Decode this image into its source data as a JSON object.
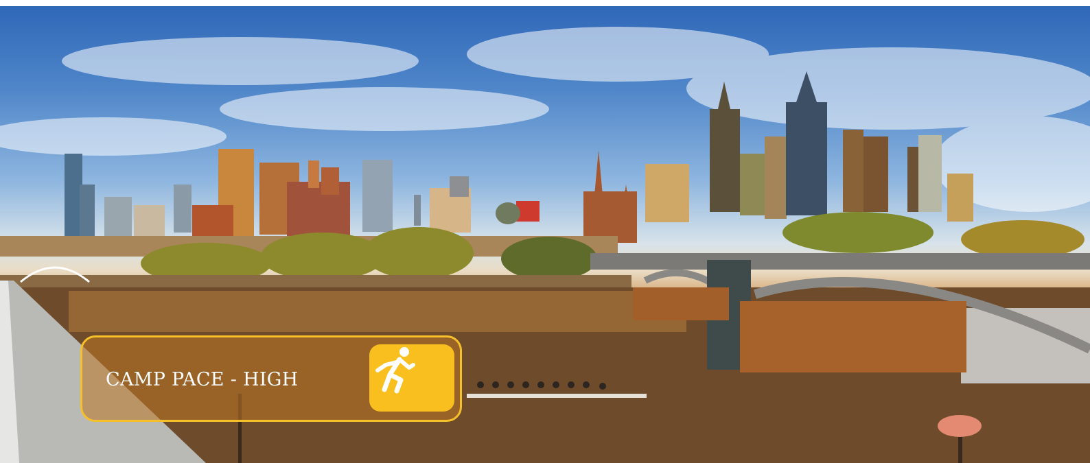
{
  "camp_pace": {
    "label": "CAMP PACE - HIGH",
    "icon": "running-person-icon",
    "accent_color": "#f6c02b",
    "tile_color": "#f8bf1f"
  }
}
